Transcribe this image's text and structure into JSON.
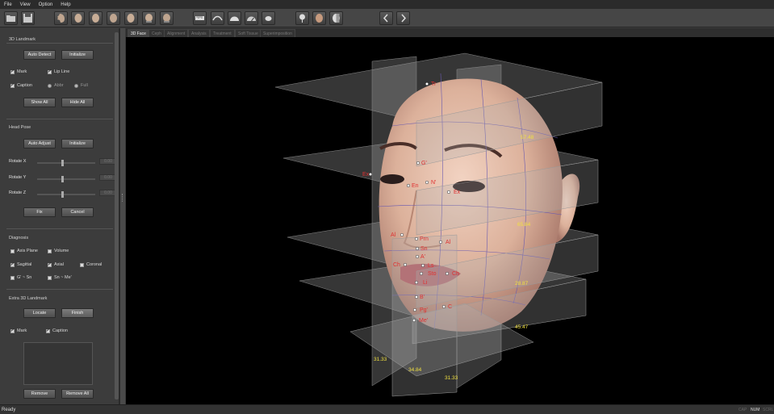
{
  "menu": [
    "File",
    "View",
    "Option",
    "Help"
  ],
  "toolbar": {
    "icons": [
      "open-folder-icon",
      "save-icon",
      "face-profile-left-icon",
      "face-three-quarter-left-icon",
      "face-front-icon",
      "face-front-alt-icon",
      "face-three-quarter-right-icon",
      "face-profile-right-icon",
      "face-top-icon",
      "ruler-icon",
      "curve-measure-icon",
      "protractor-icon",
      "arc-measure-icon",
      "shape-icon",
      "landmark-pin-icon",
      "face-texture-icon",
      "face-skull-icon",
      "back-arrow-icon",
      "forward-arrow-icon"
    ]
  },
  "left_panel": {
    "landmark": {
      "title": "3D Landmark",
      "auto_detect": "Auto Detect",
      "initialize": "Initialize",
      "mark": "Mark",
      "lip_line": "Lip Line",
      "caption": "Caption",
      "abbr": "Abbr",
      "full": "Full",
      "show_all": "Show All",
      "hide_all": "Hide All"
    },
    "head_pose": {
      "title": "Head Pose",
      "auto_adjust": "Auto Adjust",
      "initialize": "Initialize",
      "rotate_x": "Rotate X",
      "rotate_y": "Rotate Y",
      "rotate_z": "Rotate Z",
      "rx_val": "0.00",
      "ry_val": "0.00",
      "rz_val": "0.00",
      "fix": "Fix",
      "cancel": "Cancel"
    },
    "diagnosis": {
      "title": "Diagnosis",
      "axis_plane": "Axis Plane",
      "volume": "Volume",
      "sagittal": "Sagittal",
      "axial": "Axial",
      "coronal": "Coronal",
      "g_sn": "G' ~ Sn",
      "sn_me": "Sn ~ Me'"
    },
    "extra": {
      "title": "Extra 3D Landmark",
      "locate": "Locate",
      "finish": "Finish",
      "mark": "Mark",
      "caption": "Caption",
      "remove": "Remove",
      "remove_all": "Remove All"
    }
  },
  "tabs": [
    "3D Face",
    "Ceph",
    "Alignment",
    "Analysis",
    "Treatment",
    "Soft Tissue",
    "Superimposition"
  ],
  "landmarks": [
    {
      "label": "Tr"
    },
    {
      "label": "G'"
    },
    {
      "label": "N'"
    },
    {
      "label": "En"
    },
    {
      "label": "Ex"
    },
    {
      "label": "Ex"
    },
    {
      "label": "Al"
    },
    {
      "label": "Prn"
    },
    {
      "label": "Al"
    },
    {
      "label": "Sn"
    },
    {
      "label": "A'"
    },
    {
      "label": "Ch"
    },
    {
      "label": "Ls"
    },
    {
      "label": "Ch"
    },
    {
      "label": "Sto"
    },
    {
      "label": "Li"
    },
    {
      "label": "B'"
    },
    {
      "label": "Pg'"
    },
    {
      "label": "C"
    },
    {
      "label": "Me'"
    }
  ],
  "measurements": [
    "57.48",
    "65.84",
    "28.87",
    "45.47",
    "31.33",
    "34.84",
    "31.33"
  ],
  "status": {
    "text": "Ready",
    "cap": "CAP",
    "num": "NUM",
    "scrl": "SCRL"
  },
  "colors": {
    "accent": "#e03030",
    "measure": "#f0e040"
  }
}
